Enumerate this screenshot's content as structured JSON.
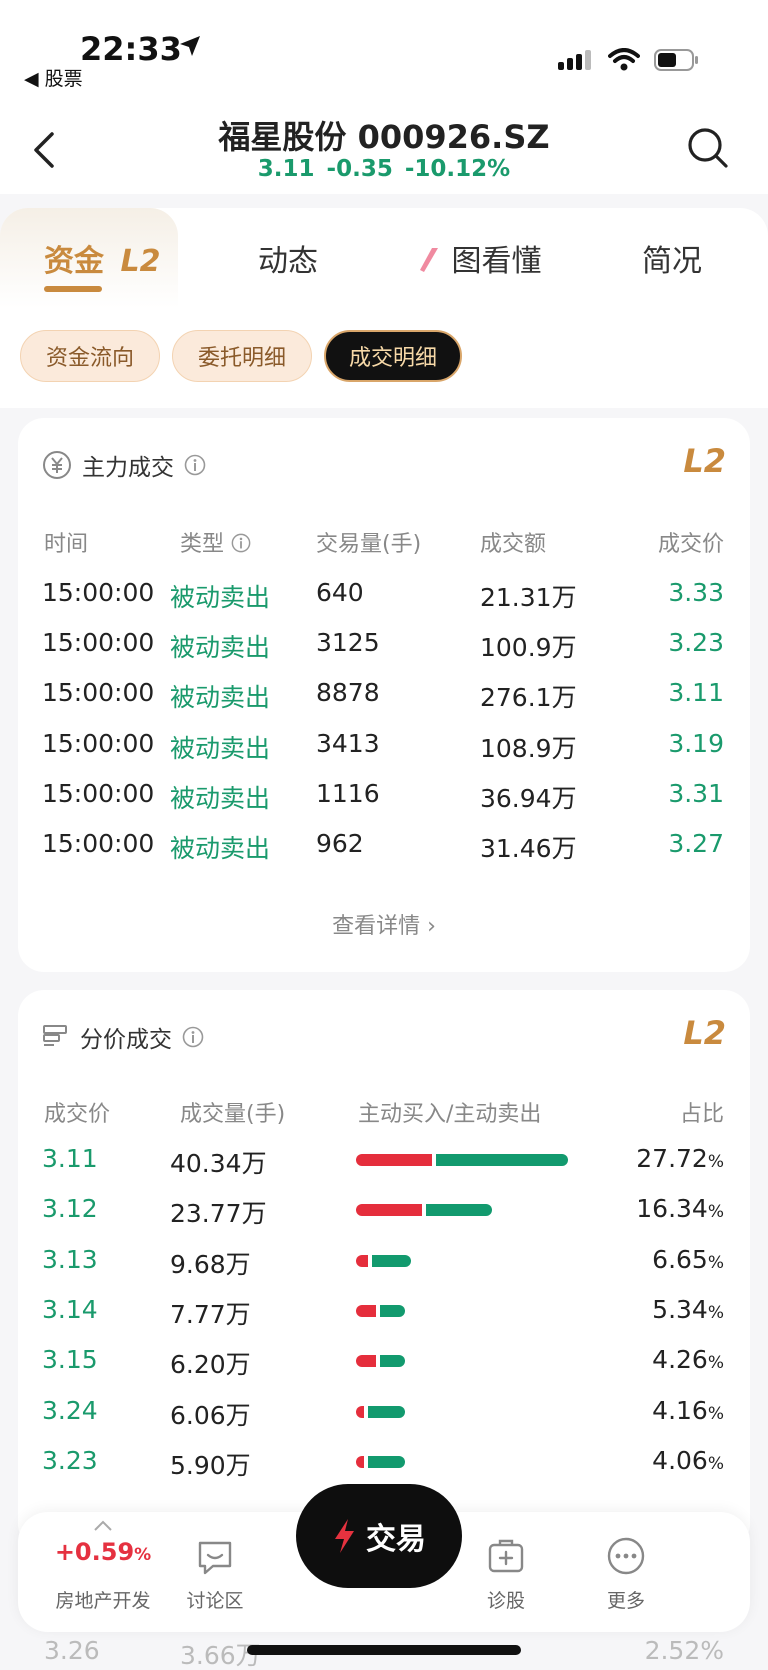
{
  "status": {
    "time": "22:33",
    "back_app": "股票"
  },
  "nav": {
    "title": "福星股份 000926.SZ",
    "price": "3.11",
    "change": "-0.35",
    "change_pct": "-10.12%"
  },
  "tabs": [
    {
      "label": "资金"
    },
    {
      "label": "动态"
    },
    {
      "label": "图看懂"
    },
    {
      "label": "简况"
    }
  ],
  "l2": "L2",
  "subtabs": [
    {
      "label": "资金流向"
    },
    {
      "label": "委托明细"
    },
    {
      "label": "成交明细"
    }
  ],
  "main_trades": {
    "title": "主力成交",
    "headers": {
      "time": "时间",
      "type": "类型",
      "volume": "交易量(手)",
      "amount": "成交额",
      "price": "成交价"
    },
    "rows": [
      {
        "time": "15:00:00",
        "type": "被动卖出",
        "volume": "640",
        "amount": "21.31万",
        "price": "3.33"
      },
      {
        "time": "15:00:00",
        "type": "被动卖出",
        "volume": "3125",
        "amount": "100.9万",
        "price": "3.23"
      },
      {
        "time": "15:00:00",
        "type": "被动卖出",
        "volume": "8878",
        "amount": "276.1万",
        "price": "3.11"
      },
      {
        "time": "15:00:00",
        "type": "被动卖出",
        "volume": "3413",
        "amount": "108.9万",
        "price": "3.19"
      },
      {
        "time": "15:00:00",
        "type": "被动卖出",
        "volume": "1116",
        "amount": "36.94万",
        "price": "3.31"
      },
      {
        "time": "15:00:00",
        "type": "被动卖出",
        "volume": "962",
        "amount": "31.46万",
        "price": "3.27"
      }
    ],
    "view_more": "查看详情"
  },
  "price_trades": {
    "title": "分价成交",
    "headers": {
      "price": "成交价",
      "volume": "成交量(手)",
      "ratio": "主动买入/主动卖出",
      "share": "占比"
    },
    "rows": [
      {
        "price": "3.11",
        "volume": "40.34万",
        "share": "27.72",
        "buy_frac": 0.37,
        "sell_frac": 0.63,
        "bar_frac": 1.0
      },
      {
        "price": "3.12",
        "volume": "23.77万",
        "share": "16.34",
        "buy_frac": 0.5,
        "sell_frac": 0.5,
        "bar_frac": 0.64
      },
      {
        "price": "3.13",
        "volume": "9.68万",
        "share": "6.65",
        "buy_frac": 0.25,
        "sell_frac": 0.75,
        "bar_frac": 0.26
      },
      {
        "price": "3.14",
        "volume": "7.77万",
        "share": "5.34",
        "buy_frac": 0.45,
        "sell_frac": 0.55,
        "bar_frac": 0.23
      },
      {
        "price": "3.15",
        "volume": "6.20万",
        "share": "4.26",
        "buy_frac": 0.45,
        "sell_frac": 0.55,
        "bar_frac": 0.23
      },
      {
        "price": "3.24",
        "volume": "6.06万",
        "share": "4.16",
        "buy_frac": 0.2,
        "sell_frac": 0.8,
        "bar_frac": 0.23
      },
      {
        "price": "3.23",
        "volume": "5.90万",
        "share": "4.06",
        "buy_frac": 0.2,
        "sell_frac": 0.8,
        "bar_frac": 0.23
      }
    ],
    "pct_sign": "%"
  },
  "bottom": {
    "sector_pct": "+0.59",
    "pct_sign": "%",
    "sector_name": "房地产开发",
    "discuss": "讨论区",
    "trade": "交易",
    "diagnose": "诊股",
    "more": "更多"
  },
  "ghost": {
    "price": "3.26",
    "volume": "3.66万",
    "share": "2.52%"
  },
  "colors": {
    "green": "#1a9a6c",
    "red": "#e53140",
    "gold": "#c98a3e"
  }
}
